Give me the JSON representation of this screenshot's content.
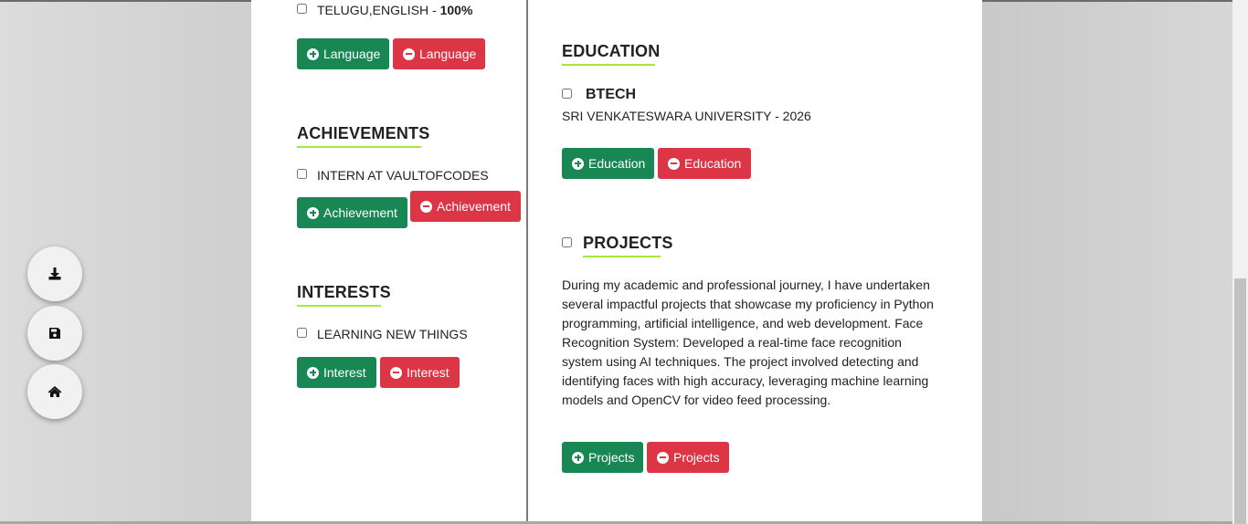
{
  "left": {
    "language_item": {
      "text": "TELUGU,ENGLISH - ",
      "percent": "100%"
    },
    "language_add": "Language",
    "language_remove": "Language",
    "achievements_heading": "ACHIEVEMENTS",
    "achievement_item": "INTERN AT VAULTOFCODES",
    "achievement_add": "Achievement",
    "achievement_remove": "Achievement",
    "interests_heading": "INTERESTS",
    "interest_item": "LEARNING NEW THINGS",
    "interest_add": "Interest",
    "interest_remove": "Interest"
  },
  "right": {
    "education_heading": "EDUCATION",
    "degree": "BTECH",
    "university": "SRI VENKATESWARA UNIVERSITY - 2026",
    "education_add": "Education",
    "education_remove": "Education",
    "projects_heading": "PROJECTS",
    "projects_text": "During my academic and professional journey, I have undertaken several impactful projects that showcase my proficiency in Python programming, artificial intelligence, and web development. Face Recognition System: Developed a real-time face recognition system using AI techniques. The project involved detecting and identifying faces with high accuracy, leveraging machine learning models and OpenCV for video feed processing.",
    "projects_add": "Projects",
    "projects_remove": "Projects"
  },
  "fabs": {
    "download": "download-icon",
    "save": "save-icon",
    "home": "home-icon"
  },
  "colors": {
    "add": "#198754",
    "remove": "#dc3545",
    "underline": "#a8e83a"
  }
}
